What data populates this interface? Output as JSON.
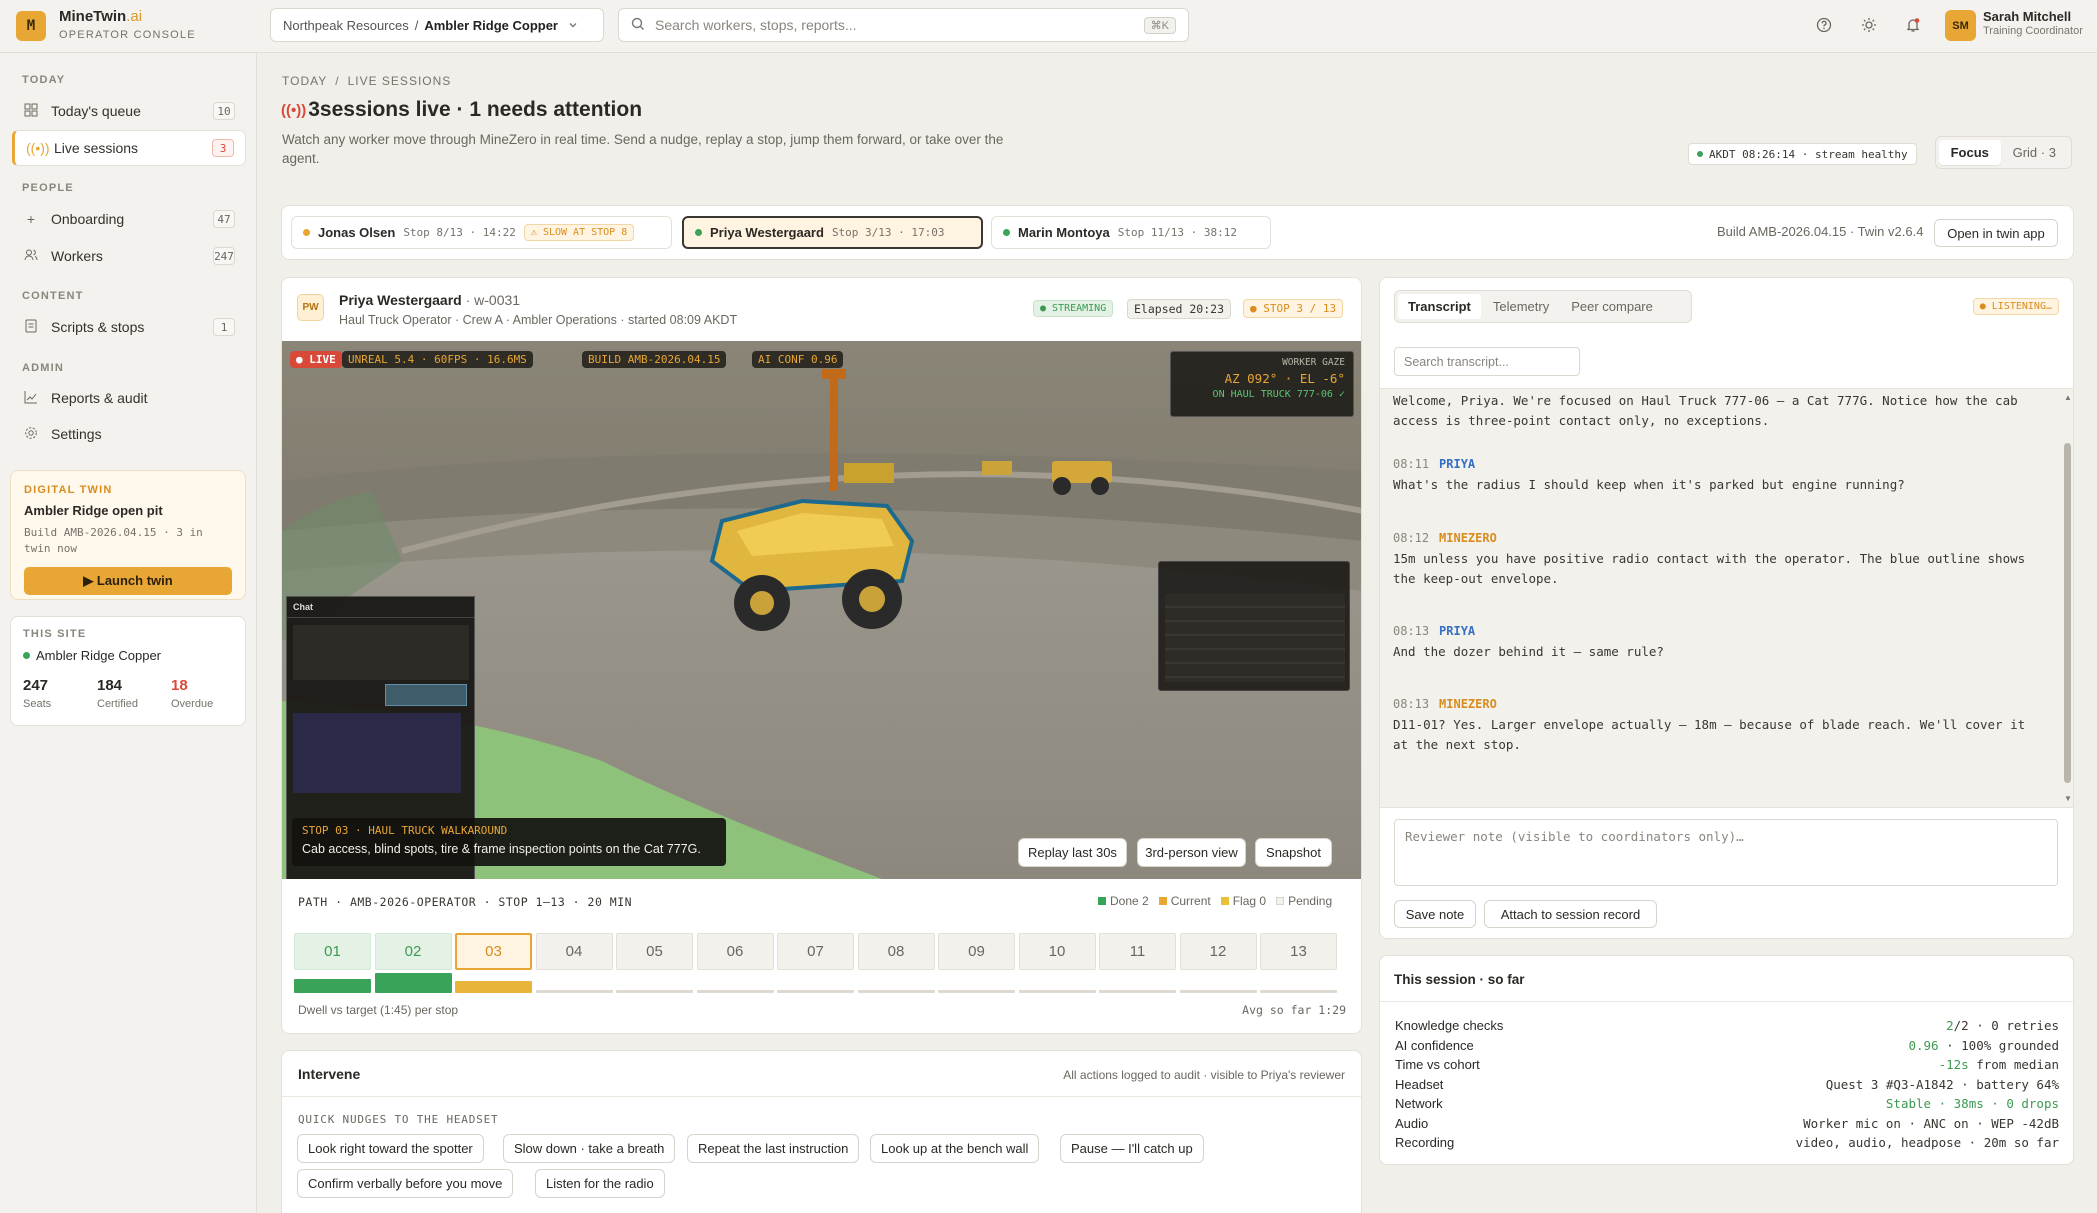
{
  "app": {
    "brand": "MineTwin",
    "brand_suffix": ".ai",
    "subtitle": "OPERATOR CONSOLE",
    "logo_letter": "M"
  },
  "topbar": {
    "org": "Northpeak Resources",
    "sep": "/",
    "site": "Ambler Ridge Copper",
    "search_placeholder": "Search workers, stops, reports...",
    "search_kbd": "⌘K",
    "user": {
      "initials": "SM",
      "name": "Sarah Mitchell",
      "role": "Training Coordinator"
    }
  },
  "sidebar": {
    "today_label": "TODAY",
    "today": [
      {
        "label": "Today's queue",
        "count": "10",
        "icon": "grid-icon"
      },
      {
        "label": "Live sessions",
        "count": "3",
        "icon": "broadcast-icon"
      }
    ],
    "people_label": "PEOPLE",
    "people": [
      {
        "label": "Onboarding",
        "count": "47",
        "icon": "plus-icon"
      },
      {
        "label": "Workers",
        "count": "247",
        "icon": "users-icon"
      }
    ],
    "content_label": "CONTENT",
    "content": [
      {
        "label": "Scripts & stops",
        "count": "1",
        "icon": "document-icon"
      }
    ],
    "admin_label": "ADMIN",
    "admin": [
      {
        "label": "Reports & audit",
        "icon": "chart-icon"
      },
      {
        "label": "Settings",
        "icon": "gear-icon"
      }
    ],
    "twin": {
      "label": "DIGITAL TWIN",
      "name": "Ambler Ridge open pit",
      "build": "Build AMB-2026.04.15 · 3 in twin now",
      "button": "▶ Launch twin"
    },
    "site": {
      "label": "THIS SITE",
      "name": "Ambler Ridge Copper",
      "stats": [
        {
          "value": "247",
          "label": "Seats"
        },
        {
          "value": "184",
          "label": "Certified"
        },
        {
          "value": "18",
          "label": "Overdue"
        }
      ]
    }
  },
  "page": {
    "breadcrumb_a": "TODAY",
    "breadcrumb_sep": "/",
    "breadcrumb_b": "LIVE SESSIONS",
    "title_count": "3",
    "title_rest": "sessions live · 1 needs attention",
    "description": "Watch any worker move through MineZero in real time. Send a nudge, replay a stop, jump them forward, or take over the agent.",
    "stream_status": "AKDT 08:26:14 · stream healthy",
    "view_focus": "Focus",
    "view_grid": "Grid · 3"
  },
  "sessions": [
    {
      "name": "Jonas Olsen",
      "meta": "Stop 8/13 · 14:22",
      "flag": "⚠ SLOW AT STOP 8",
      "dot": "#e8a634"
    },
    {
      "name": "Priya Westergaard",
      "meta": "Stop 3/13 · 17:03",
      "dot": "#3aa35a"
    },
    {
      "name": "Marin Montoya",
      "meta": "Stop 11/13 · 38:12",
      "dot": "#3aa35a"
    }
  ],
  "build_info": "Build AMB-2026.04.15 · Twin v2.6.4",
  "open_twin_label": "Open in twin app",
  "worker": {
    "initials": "PW",
    "name": "Priya Westergaard",
    "id": "· w-0031",
    "meta": "Haul Truck Operator · Crew A · Ambler Operations · started 08:09 AKDT",
    "streaming": "● STREAMING",
    "elapsed": "Elapsed 20:23",
    "stop": "● STOP 3 / 13"
  },
  "viewport": {
    "live": "● LIVE",
    "engine": "UNREAL 5.4 · 60FPS · 16.6MS",
    "build": "BUILD AMB-2026.04.15",
    "ai_conf": "AI CONF 0.96",
    "gaze_label": "WORKER GAZE",
    "gaze_value": "AZ 092° · EL -6°",
    "gaze_target": "ON HAUL TRUCK 777-06 ✓",
    "chat_title": "Chat",
    "stop_label": "STOP 03 · HAUL TRUCK WALKAROUND",
    "stop_desc": "Cab access, blind spots, tire & frame inspection points on the Cat 777G.",
    "btn_replay": "Replay last 30s",
    "btn_third": "3rd-person view",
    "btn_snapshot": "Snapshot"
  },
  "path": {
    "label": "PATH · AMB-2026-OPERATOR · STOP 1–13 · 20 MIN",
    "legend": {
      "done": "Done 2",
      "current": "Current",
      "flag": "Flag 0",
      "pending": "Pending"
    },
    "steps": [
      "01",
      "02",
      "03",
      "04",
      "05",
      "06",
      "07",
      "08",
      "09",
      "10",
      "11",
      "12",
      "13"
    ],
    "step_status": [
      "done",
      "done",
      "current",
      "pending",
      "pending",
      "pending",
      "pending",
      "pending",
      "pending",
      "pending",
      "pending",
      "pending",
      "pending"
    ],
    "dwell_fraction": [
      0.55,
      0.75,
      0.45,
      0,
      0,
      0,
      0,
      0,
      0,
      0,
      0,
      0,
      0
    ],
    "dwell_label": "Dwell vs target (1:45) per stop",
    "avg": "Avg so far 1:29"
  },
  "intervene": {
    "title": "Intervene",
    "note": "All actions logged to audit · visible to Priya's reviewer",
    "nudges_label": "QUICK NUDGES TO THE HEADSET",
    "nudges": [
      "Look right toward the spotter",
      "Slow down · take a breath",
      "Repeat the last instruction",
      "Look up at the bench wall",
      "Pause — I'll catch up",
      "Confirm verbally before you move",
      "Listen for the radio"
    ]
  },
  "transcript": {
    "tabs": [
      "Transcript",
      "Telemetry",
      "Peer compare"
    ],
    "listening": "● LISTENING…",
    "search_placeholder": "Search transcript...",
    "intro": "Welcome, Priya. We're focused on Haul Truck 777-06 — a Cat 777G. Notice how the cab access is three-point contact only, no exceptions.",
    "messages": [
      {
        "time": "08:11",
        "speaker": "PRIYA",
        "text": "What's the radius I should keep when it's parked but engine running?"
      },
      {
        "time": "08:12",
        "speaker": "MINEZERO",
        "text": "15m unless you have positive radio contact with the operator. The blue outline shows the keep-out envelope."
      },
      {
        "time": "08:13",
        "speaker": "PRIYA",
        "text": "And the dozer behind it — same rule?"
      },
      {
        "time": "08:13",
        "speaker": "MINEZERO",
        "text": "D11-01? Yes. Larger envelope actually — 18m — because of blade reach. We'll cover it at the next stop."
      }
    ],
    "note_placeholder": "Reviewer note (visible to coordinators only)…",
    "save_note": "Save note",
    "attach": "Attach to session record"
  },
  "summary": {
    "title": "This session · so far",
    "rows": [
      {
        "label": "Knowledge checks",
        "a": "2",
        "b": "/2 · 0 retries"
      },
      {
        "label": "AI confidence",
        "a": "0.96",
        "b": " · 100% grounded"
      },
      {
        "label": "Time vs cohort",
        "a": "-12s",
        "b": " from median"
      },
      {
        "label": "Headset",
        "a": "",
        "b": "Quest 3 #Q3-A1842 · battery 64%"
      },
      {
        "label": "Network",
        "a": "Stable · 38ms · 0 drops",
        "b": ""
      },
      {
        "label": "Audio",
        "a": "",
        "b": "Worker mic on · ANC on · WEP -42dB"
      },
      {
        "label": "Recording",
        "a": "",
        "b": "video, audio, headpose · 20m so far"
      }
    ]
  },
  "colors": {
    "accent": "#e8a634",
    "done": "#3aa35a",
    "live": "#d9493a"
  }
}
